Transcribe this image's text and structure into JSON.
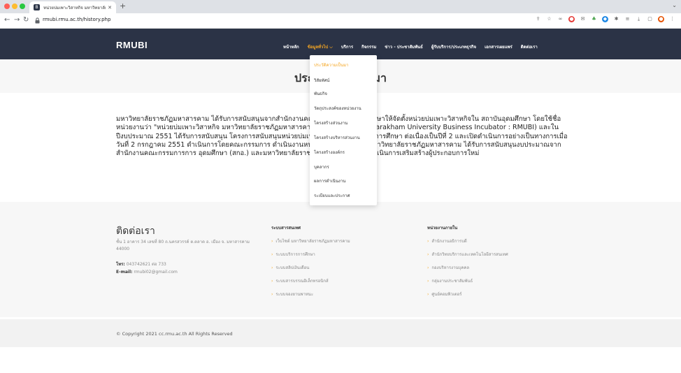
{
  "browser": {
    "tab_title": "หน่วยบ่มเพาะวิสาหกิจ มหาวิทยาลัย",
    "tab_favicon": "B",
    "url": "rmubi.rmu.ac.th/history.php"
  },
  "header": {
    "logo": "RMUBI",
    "nav": [
      {
        "label": "หน้าหลัก"
      },
      {
        "label": "ข้อมูลทั่วไป ⌵"
      },
      {
        "label": "บริการ"
      },
      {
        "label": "กิจกรรม"
      },
      {
        "label": "ข่าว - ประชาสัมพันธ์"
      },
      {
        "label": "ผู้รับบริการ/ประเภทธุรกิจ"
      },
      {
        "label": "เอกสารเผยแพร่"
      },
      {
        "label": "ติดต่อเรา"
      }
    ]
  },
  "dropdown": {
    "items": [
      {
        "label": "ประวัติความเป็นมา"
      },
      {
        "label": "วิสัยทัศน์"
      },
      {
        "label": "พันธกิจ"
      },
      {
        "label": "วัตถุประสงค์ของหน่วยงาน"
      },
      {
        "label": "โครงสร้างส่วนงาน"
      },
      {
        "label": "โครงสร้างบริหารส่วนงาน"
      },
      {
        "label": "โครงสร้างองค์กร"
      },
      {
        "label": "บุคลากร"
      },
      {
        "label": "ผลการดำเนินงาน"
      },
      {
        "label": "ระเบียบและประกาศ"
      }
    ]
  },
  "page": {
    "title": "ประวัติความเป็นมา",
    "body": "มหาวิทยาลัยราชภัฏมหาสารคาม ได้รับการสนับสนุนจากสำนักงานคณะกรรมการการอุดมศึกษาให้จัดตั้งหน่วยบ่มเพาะวิสาหกิจใน สถาบันอุดมศึกษา โดยใช้ชื่อหน่วยงานว่า \"หน่วยบ่มเพาะวิสาหกิจ มหาวิทยาลัยราชภัฏมหาสารคาม (Rajabhat Maha Sarakham University Business Incubator : RMUBI) และในปีงบประมาณ 2551 ได้รับการสนับสนุน โครงการสนับสนุนหน่วยบ่มเพาะ วิสาหกิจในสถาบันการศึกษา ต่อเนื่องเป็นปีที่ 2 และเปิดดำเนินการอย่างเป็นทางการเมื่อวันที่ 2 กรกฎาคม 2551 ดำเนินการโดยคณะกรรมการ ดำเนินงานหน่วยบ่มเพาะวิสาหกิจ มหาวิทยาลัยราชภัฏมหาสารคาม ได้รับการสนับสนุนงบประมาณจากสำนักงานคณะกรรมการการ อุดมศึกษา (สกอ.) และมหาวิทยาลัยราชภัฏมหาสารคาม เพื่อดำเนินการเสริมสร้างผู้ประกอบการใหม่"
  },
  "footer": {
    "contact_title": "ติดต่อเรา",
    "address": "ชั้น 1 อาคาร 34 เลขที่ 80 ถ.นครสวรรค์ ต.ตลาด อ. เมือง จ. มหาสารคาม 44000",
    "phone_label": "โทร:",
    "phone": "043742621 ต่อ 733",
    "email_label": "E-mail:",
    "email": "rmubi02@gmail.com",
    "col2_title": "ระบบสารสนเทศ",
    "col2_links": [
      "เว็บไซต์ มหาวิทยาลัยราชภัฏมหาสารคาม",
      "ระบบบริการการศึกษา",
      "ระบบสลิปเงินเดือน",
      "ระบบสารบรรณอิเล็กทรอนิกส์",
      "ระบบจองยานพาหนะ"
    ],
    "col3_title": "หน่วยงานภายใน",
    "col3_links": [
      "สำนักงานอธิการบดี",
      "สำนักวิทยบริการและเทคโนโลยีสารสนเทศ",
      "กองบริหารงานบุคคล",
      "กลุ่มงานประชาสัมพันธ์",
      "ศูนย์คอมพิวเตอร์"
    ],
    "copyright": "© Copyright 2021 cc.rmu.ac.th All Rights Reserved"
  },
  "colors": {
    "header_bg": "#2b3346",
    "accent": "#f5a623"
  }
}
